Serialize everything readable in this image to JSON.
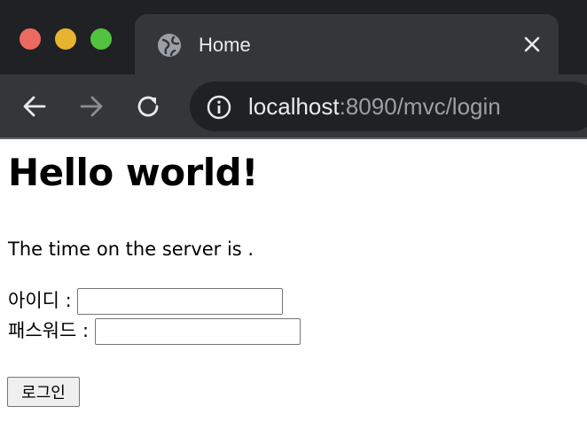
{
  "browser": {
    "tab_title": "Home",
    "url_host": "localhost",
    "url_rest": ":8090/mvc/login",
    "icons": {
      "favicon": "globe-icon",
      "close": "close-icon",
      "back": "arrow-left-icon",
      "forward": "arrow-right-icon",
      "reload": "reload-icon",
      "info": "info-icon"
    }
  },
  "page": {
    "heading": "Hello world!",
    "time_text": "The time on the server is .",
    "form": {
      "id_label": "아이디 :",
      "id_value": "",
      "password_label": "패스워드 :",
      "password_value": "",
      "submit_label": "로그인"
    }
  }
}
